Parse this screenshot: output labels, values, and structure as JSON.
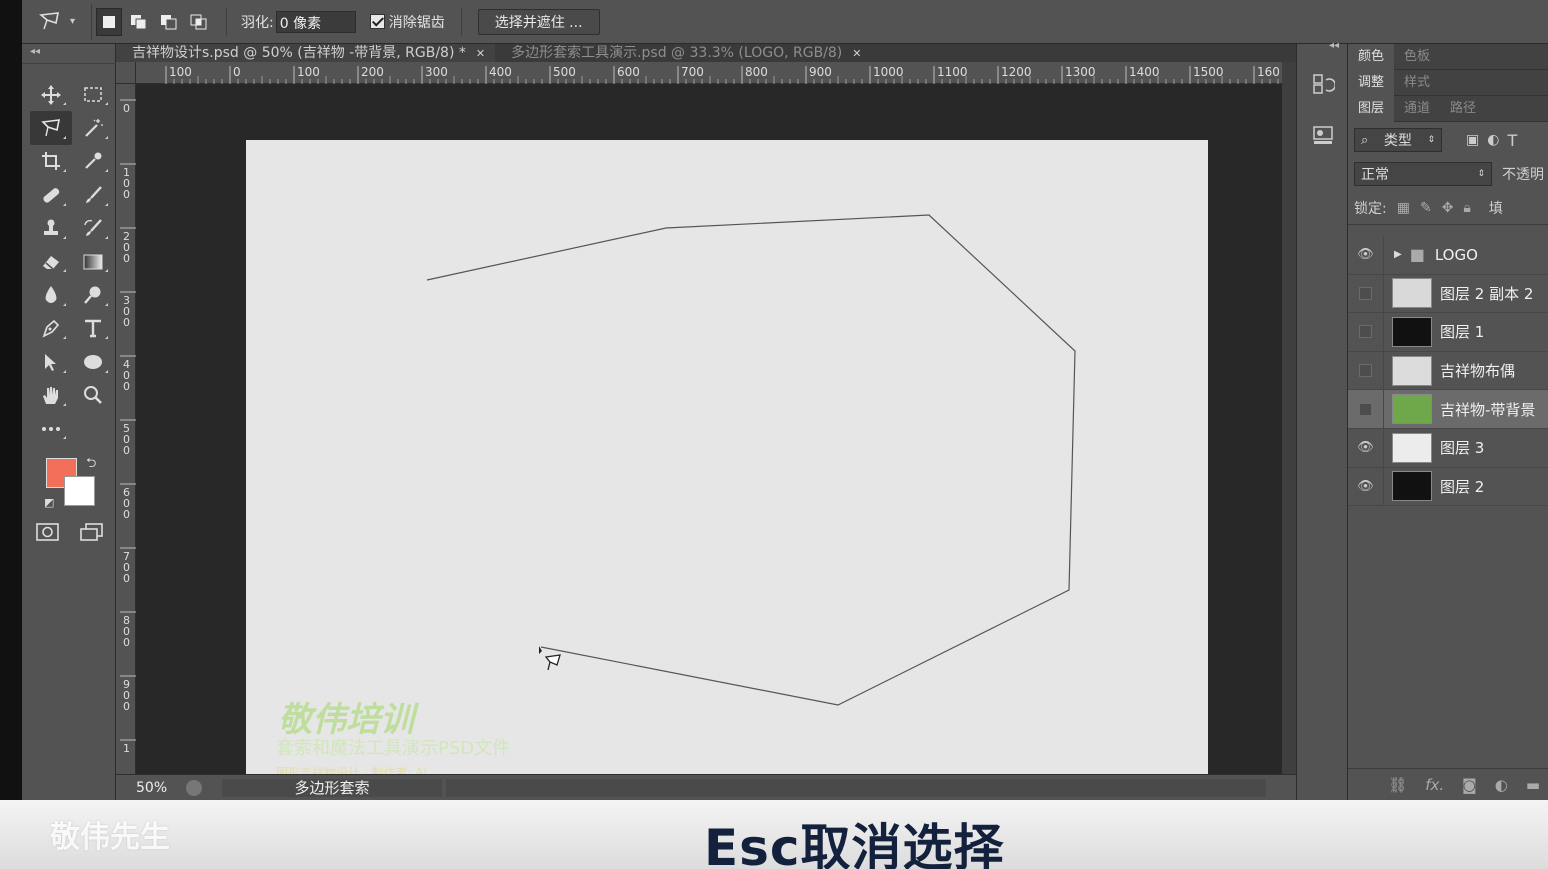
{
  "options_bar": {
    "feather_label": "羽化:",
    "feather_value": "0 像素",
    "antialias_label": "消除锯齿",
    "antialias_checked": true,
    "select_mask_button": "选择并遮住 ..."
  },
  "tabs": [
    {
      "label": "吉祥物设计s.psd @ 50% (吉祥物 -带背景, RGB/8) *",
      "active": true
    },
    {
      "label": "多边形套索工具演示.psd @ 33.3% (LOGO, RGB/8)",
      "active": false
    }
  ],
  "ruler": {
    "h_ticks": [
      "100",
      "0",
      "100",
      "200",
      "300",
      "400",
      "500",
      "600",
      "700",
      "800",
      "900",
      "1000",
      "1100",
      "1200",
      "1300",
      "1400",
      "1500",
      "160"
    ],
    "v_ticks": [
      "0",
      "100",
      "200",
      "300",
      "400",
      "500",
      "600",
      "700",
      "800",
      "900",
      "1"
    ]
  },
  "canvas": {
    "watermark_title": "敬伟培训",
    "watermark_subtitle": "套索和魔法工具演示PSD文件",
    "watermark_line3": "图形吉祥物设计 · 制作者: AI"
  },
  "status": {
    "zoom": "50%",
    "tool_name": "多边形套索"
  },
  "panels": {
    "row1_tabs": [
      "颜色",
      "色板"
    ],
    "row2_tabs": [
      "调整",
      "样式"
    ],
    "row3_tabs": [
      "图层",
      "通道",
      "路径"
    ],
    "filter_label": "类型",
    "blend_mode": "正常",
    "opacity_label": "不透明",
    "lock_label": "锁定:",
    "fill_label": "填"
  },
  "layers": [
    {
      "name": "LOGO",
      "visible": true,
      "group": true,
      "selected": false,
      "thumb": "#535353"
    },
    {
      "name": "图层 2 副本 2",
      "visible": false,
      "group": false,
      "selected": false,
      "thumb": "#d9d9d9"
    },
    {
      "name": "图层 1",
      "visible": false,
      "group": false,
      "selected": false,
      "thumb": "#111111"
    },
    {
      "name": "吉祥物布偶",
      "visible": false,
      "group": false,
      "selected": false,
      "thumb": "#dcdcdc"
    },
    {
      "name": "吉祥物-带背景",
      "visible": false,
      "group": false,
      "selected": true,
      "thumb": "#6ea84a"
    },
    {
      "name": "图层 3",
      "visible": true,
      "group": false,
      "selected": false,
      "thumb": "#ececec"
    },
    {
      "name": "图层 2",
      "visible": true,
      "group": false,
      "selected": false,
      "thumb": "#111111"
    }
  ],
  "caption": "Esc取消选择",
  "corner_watermark": "敬伟先生",
  "colors": {
    "foreground": "#f2705a",
    "background": "#ffffff"
  }
}
